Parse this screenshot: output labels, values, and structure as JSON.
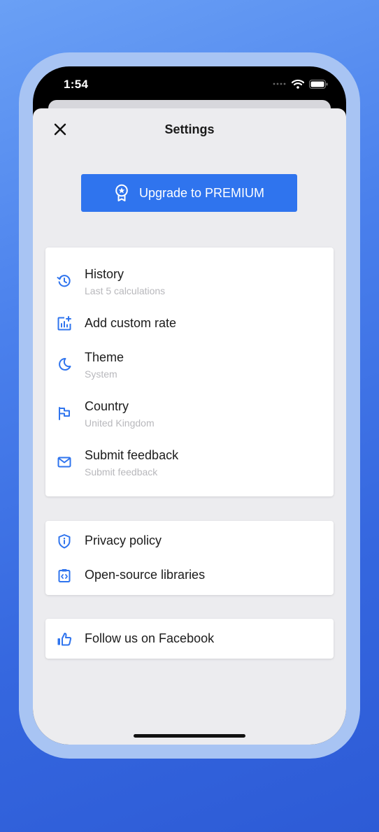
{
  "status_bar": {
    "time": "1:54"
  },
  "header": {
    "title": "Settings",
    "close_icon": "close-icon"
  },
  "premium": {
    "label": "Upgrade to PREMIUM",
    "icon": "award-badge-icon"
  },
  "colors": {
    "accent": "#2f74ee",
    "sheet_bg": "#ececef",
    "card_bg": "#ffffff",
    "subtext": "#b8b8bc"
  },
  "main_group": {
    "items": [
      {
        "label": "History",
        "sublabel": "Last 5 calculations",
        "icon": "history-icon"
      },
      {
        "label": "Add custom rate",
        "icon": "add-chart-icon"
      },
      {
        "label": "Theme",
        "sublabel": "System",
        "icon": "moon-icon"
      },
      {
        "label": "Country",
        "sublabel": "United Kingdom",
        "icon": "flag-icon"
      },
      {
        "label": "Submit feedback",
        "sublabel": "Submit feedback",
        "icon": "mail-icon"
      }
    ]
  },
  "legal_group": {
    "items": [
      {
        "label": "Privacy policy",
        "icon": "shield-info-icon"
      },
      {
        "label": "Open-source libraries",
        "icon": "code-clipboard-icon"
      }
    ]
  },
  "social_group": {
    "items": [
      {
        "label": "Follow us on Facebook",
        "icon": "thumbs-up-icon"
      }
    ]
  }
}
